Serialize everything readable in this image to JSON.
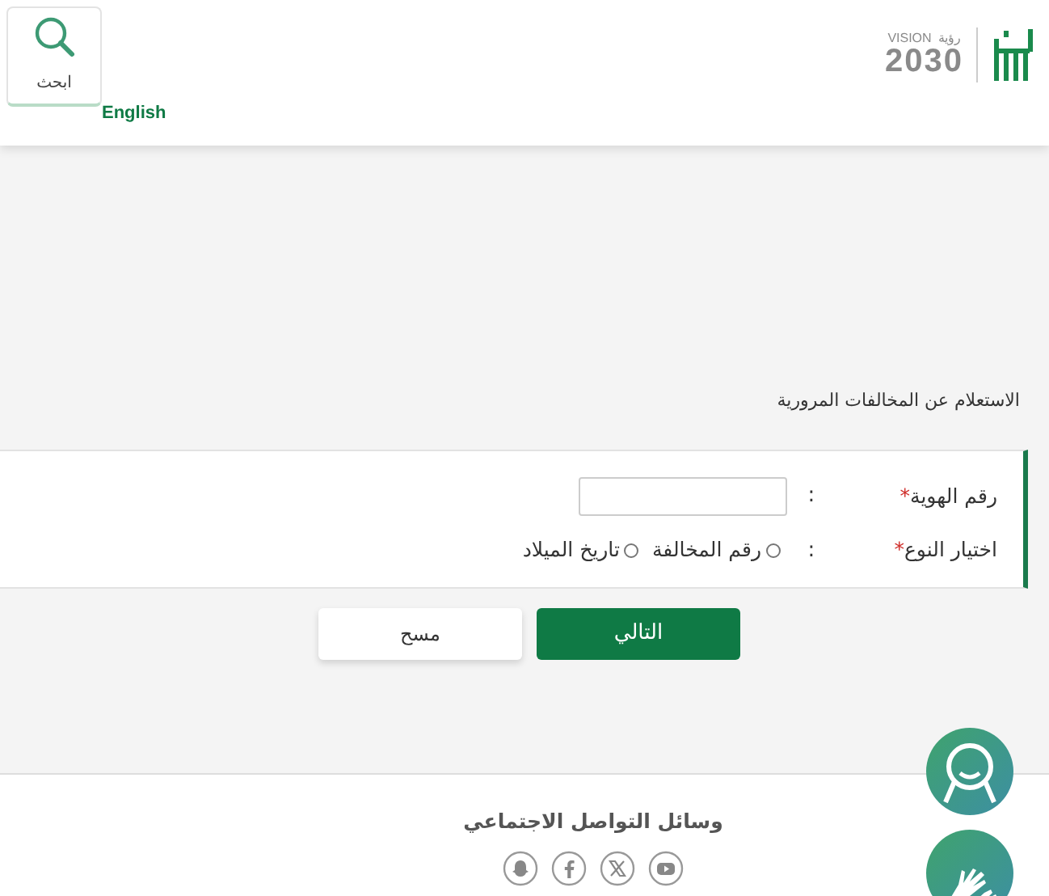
{
  "header": {
    "search_button": "ابحث",
    "language_link": "English",
    "logo": {
      "vision": "VISION",
      "vision_ar": "رؤية",
      "year": "2030"
    }
  },
  "page_title": "الاستعلام عن المخالفات المرورية",
  "form": {
    "required_mark": "*",
    "separator": ":",
    "id_field": {
      "label": "رقم الهوية"
    },
    "type_field": {
      "label": "اختيار النوع",
      "options": [
        {
          "label": "رقم المخالفة",
          "selected": false
        },
        {
          "label": "تاريخ الميلاد",
          "selected": false
        }
      ]
    }
  },
  "buttons": [
    {
      "label": "التالي",
      "kind": "primary"
    },
    {
      "label": "مسح",
      "kind": "secondary"
    }
  ],
  "footer": {
    "title": "وسائل التواصل الاجتماعي"
  }
}
